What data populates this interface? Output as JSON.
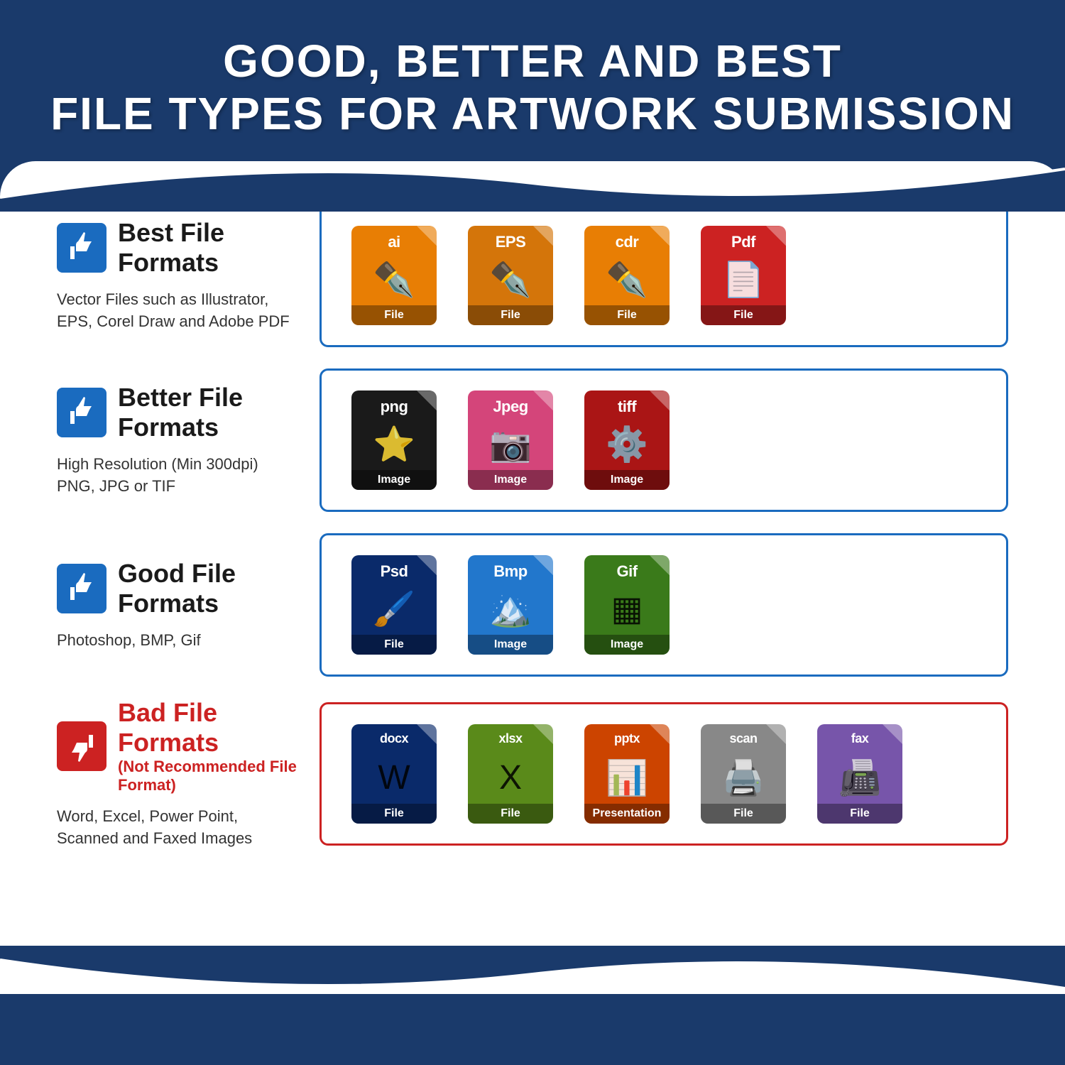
{
  "title": {
    "line1": "GOOD, BETTER AND BEST",
    "line2": "FILE TYPES FOR ARTWORK SUBMISSION"
  },
  "rows": [
    {
      "id": "best",
      "label": "Best File Formats",
      "sublabel": null,
      "desc": "Vector Files such as Illustrator,\nEPS, Corel Draw and Adobe PDF",
      "thumbDirection": "up",
      "borderColor": "blue",
      "files": [
        {
          "ext": "ai",
          "color": "orange",
          "sublabel": "File",
          "icon": "pen"
        },
        {
          "ext": "EPS",
          "color": "orange2",
          "sublabel": "File",
          "icon": "pen"
        },
        {
          "ext": "cdr",
          "color": "orange",
          "sublabel": "File",
          "icon": "pen"
        },
        {
          "ext": "Pdf",
          "color": "red",
          "sublabel": "File",
          "icon": "doc"
        }
      ]
    },
    {
      "id": "better",
      "label": "Better File Formats",
      "sublabel": null,
      "desc": "High Resolution (Min 300dpi)\nPNG, JPG or TIF",
      "thumbDirection": "up",
      "borderColor": "blue",
      "files": [
        {
          "ext": "png",
          "color": "black",
          "sublabel": "Image",
          "icon": "star"
        },
        {
          "ext": "Jpeg",
          "color": "pink",
          "sublabel": "Image",
          "icon": "camera"
        },
        {
          "ext": "tiff",
          "color": "darkred",
          "sublabel": "Image",
          "icon": "gear"
        }
      ]
    },
    {
      "id": "good",
      "label": "Good File Formats",
      "sublabel": null,
      "desc": "Photoshop, BMP, Gif",
      "thumbDirection": "up",
      "borderColor": "blue",
      "files": [
        {
          "ext": "Psd",
          "color": "navyblue",
          "sublabel": "File",
          "icon": "brush"
        },
        {
          "ext": "Bmp",
          "color": "skyblue",
          "sublabel": "Image",
          "icon": "landscape"
        },
        {
          "ext": "Gif",
          "color": "green",
          "sublabel": "Image",
          "icon": "grid"
        }
      ]
    },
    {
      "id": "bad",
      "label": "Bad File Formats",
      "sublabel": "(Not Recommended File Format)",
      "desc": "Word, Excel, Power Point,\nScanned and Faxed Images",
      "thumbDirection": "down",
      "borderColor": "red",
      "files": [
        {
          "ext": "docx",
          "color": "navyblue",
          "sublabel": "File",
          "icon": "word"
        },
        {
          "ext": "xlsx",
          "color": "olivegreen",
          "sublabel": "File",
          "icon": "excel"
        },
        {
          "ext": "pptx",
          "color": "orange-red",
          "sublabel": "Presentation",
          "icon": "chart"
        },
        {
          "ext": "scan",
          "color": "gray",
          "sublabel": "File",
          "icon": "scanner"
        },
        {
          "ext": "fax",
          "color": "purple",
          "sublabel": "File",
          "icon": "fax"
        }
      ]
    }
  ]
}
